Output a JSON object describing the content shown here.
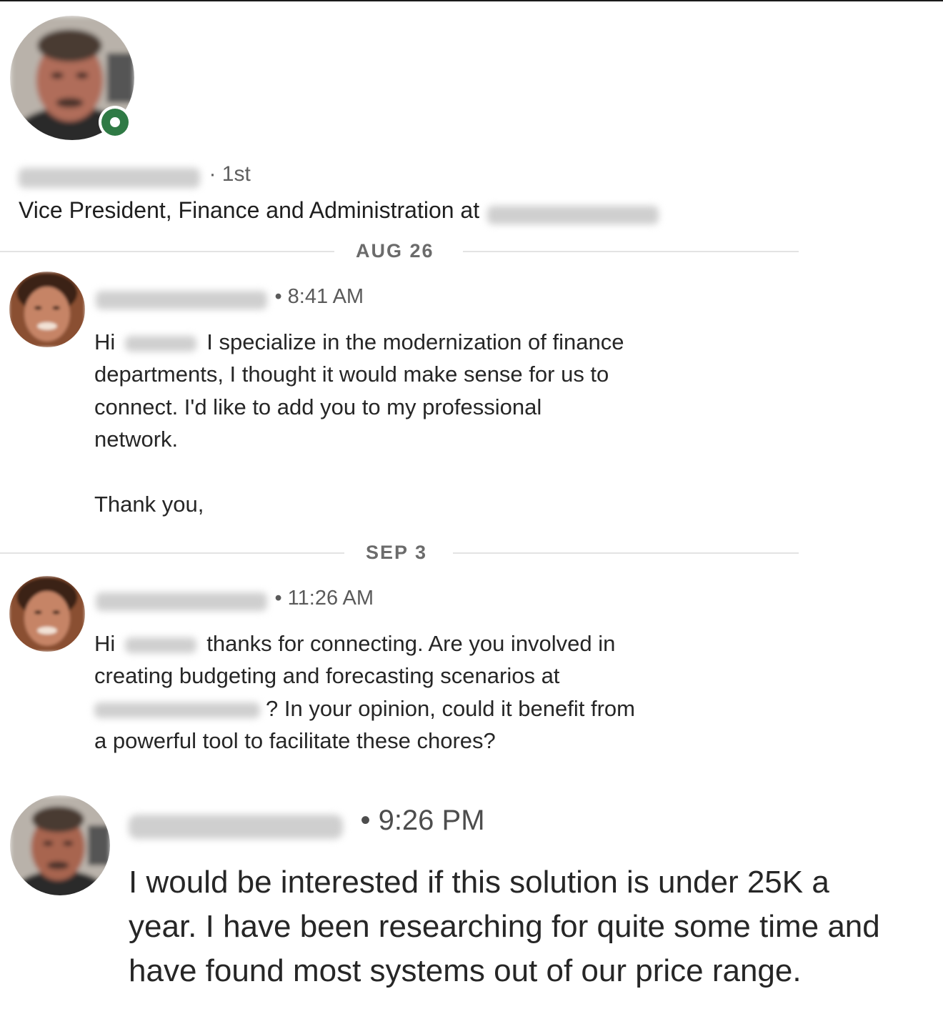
{
  "profile": {
    "degree": "· 1st",
    "headline": "Vice President, Finance and Administration at",
    "presence": "online"
  },
  "thread": [
    {
      "date": "AUG 26",
      "time": "• 8:41 AM",
      "lines": [
        "Hi",
        "I specialize in the modernization of finance",
        "departments, I thought it would make sense for us to",
        "connect. I'd like to add you to my professional",
        "network.",
        "Thank you,"
      ]
    },
    {
      "date": "SEP 3",
      "time": "• 11:26 AM",
      "lines": [
        "Hi",
        "thanks for connecting. Are you involved in",
        "creating budgeting and forecasting scenarios at",
        "? In your opinion, could it benefit from",
        "a powerful tool to facilitate these chores?"
      ]
    }
  ],
  "reply": {
    "time": "• 9:26 PM",
    "lines": [
      "I would be interested if this solution is under 25K a",
      "year. I have been researching for quite some time and",
      "have found most systems out of our price range."
    ]
  },
  "colors": {
    "presence_green": "#2f7a45",
    "divider": "#e3e3e3",
    "text": "#262626"
  }
}
